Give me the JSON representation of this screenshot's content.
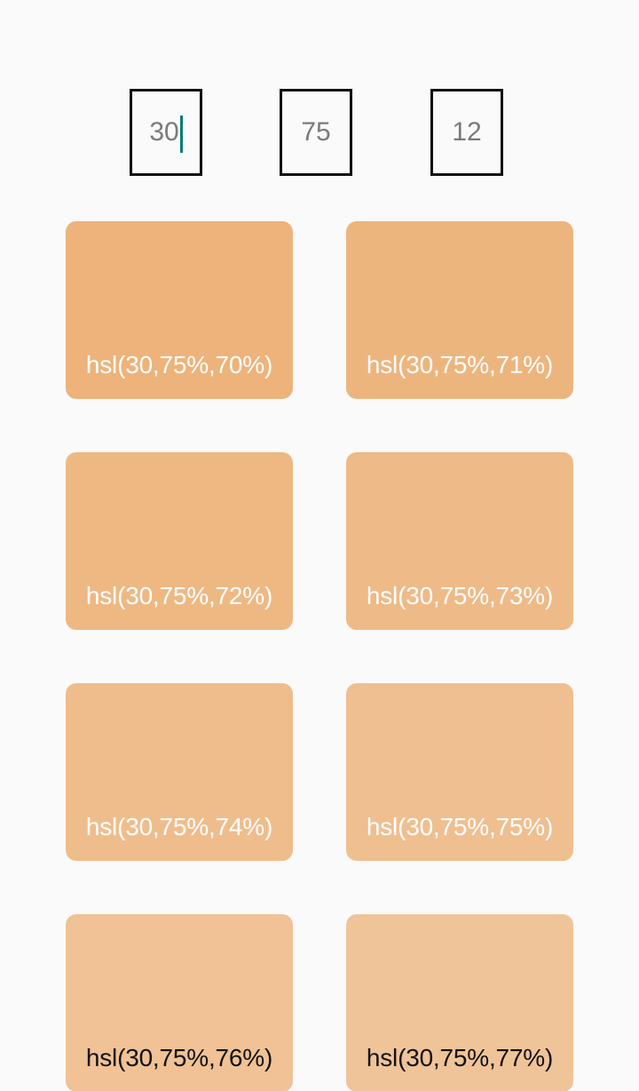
{
  "inputs": {
    "hue": "30",
    "saturation": "75",
    "lightness": "12"
  },
  "colors": {
    "caret": "#0a7c73",
    "background": "#fafafa"
  },
  "swatches": [
    {
      "label": "hsl(30,75%,70%)",
      "color": "#edb37a",
      "text": "light"
    },
    {
      "label": "hsl(30,75%,71%)",
      "color": "#edb57e",
      "text": "light"
    },
    {
      "label": "hsl(30,75%,72%)",
      "color": "#eeb883",
      "text": "light"
    },
    {
      "label": "hsl(30,75%,73%)",
      "color": "#eeba87",
      "text": "light"
    },
    {
      "label": "hsl(30,75%,74%)",
      "color": "#efbd8c",
      "text": "light"
    },
    {
      "label": "hsl(30,75%,75%)",
      "color": "#efbf90",
      "text": "light"
    },
    {
      "label": "hsl(30,75%,76%)",
      "color": "#f0c295",
      "text": "dark"
    },
    {
      "label": "hsl(30,75%,77%)",
      "color": "#f0c499",
      "text": "dark"
    }
  ]
}
